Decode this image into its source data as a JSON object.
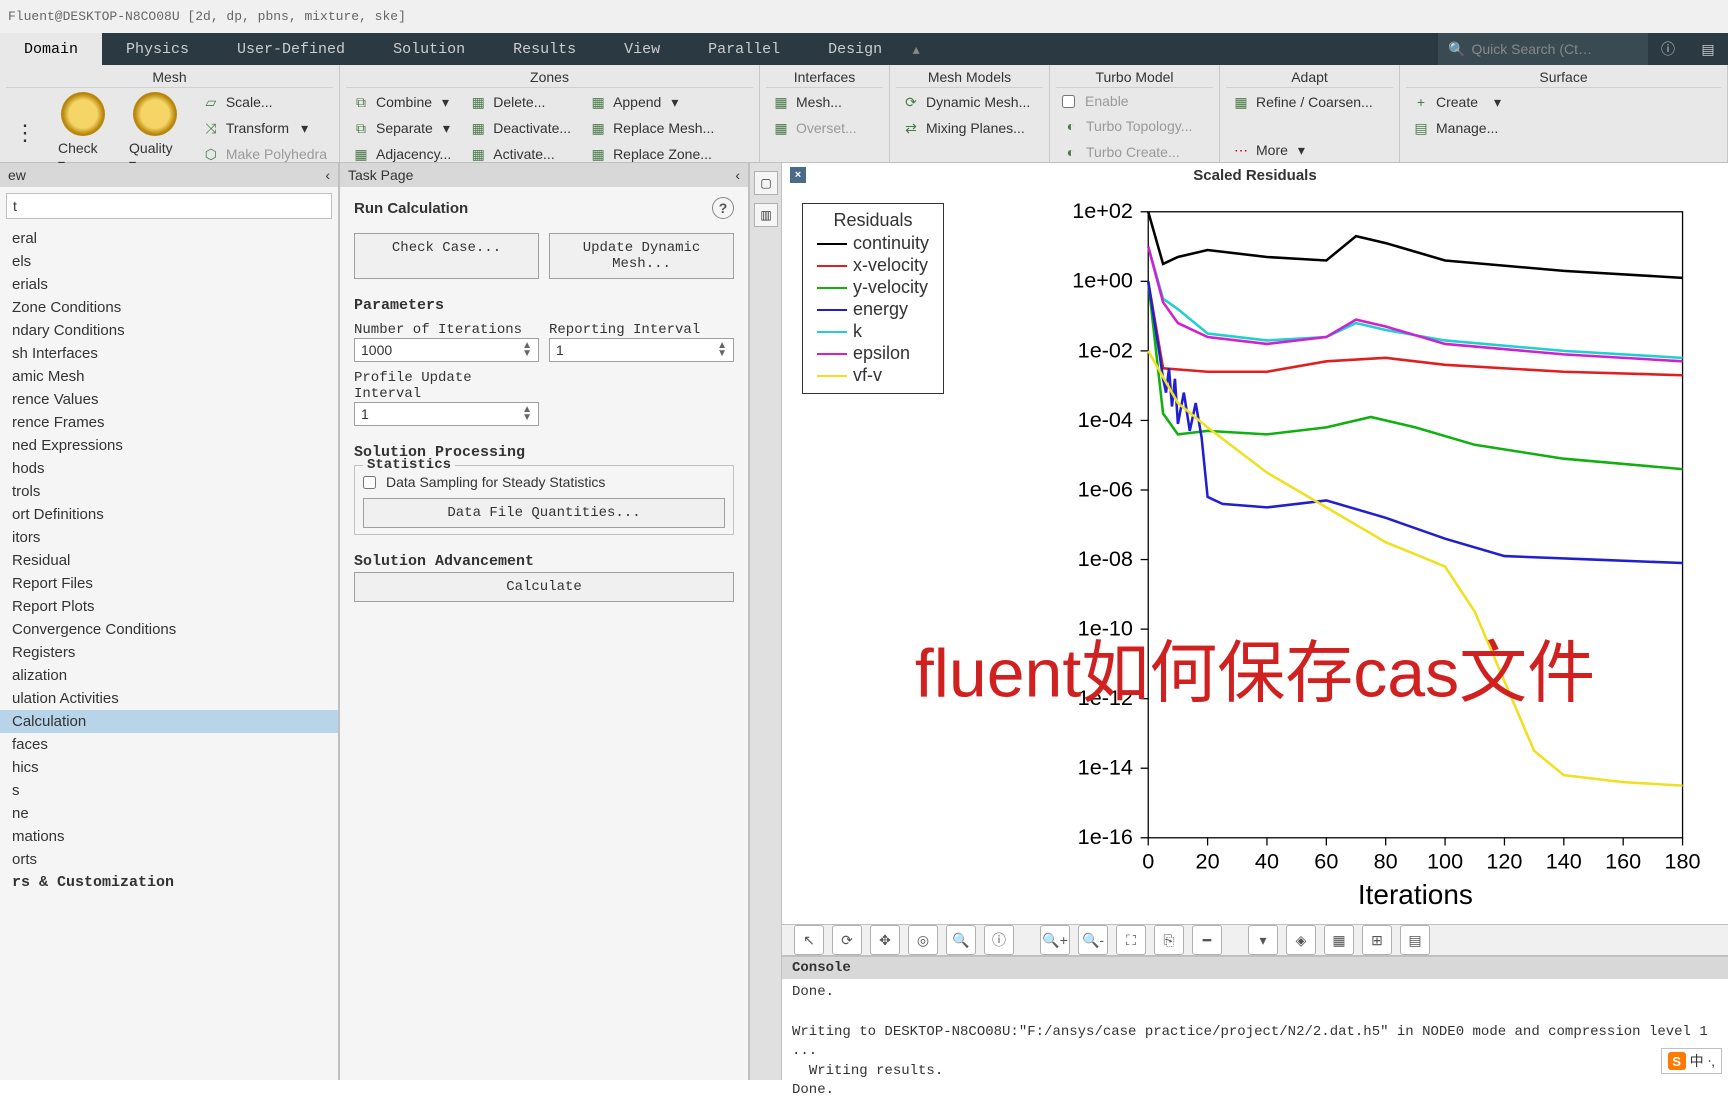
{
  "titlebar": "Fluent@DESKTOP-N8CO08U [2d, dp, pbns, mixture, ske]",
  "menu": {
    "tabs": [
      "Domain",
      "Physics",
      "User-Defined",
      "Solution",
      "Results",
      "View",
      "Parallel",
      "Design"
    ],
    "active": 0,
    "search_placeholder": "Quick Search (Ct…"
  },
  "ribbon": {
    "mesh": {
      "title": "Mesh",
      "check": "Check ▾",
      "quality": "Quality ▾",
      "scale": "Scale...",
      "transform": "Transform",
      "make_poly": "Make Polyhedra"
    },
    "zones": {
      "title": "Zones",
      "combine": "Combine",
      "delete": "Delete...",
      "append": "Append",
      "separate": "Separate",
      "deactivate": "Deactivate...",
      "replace_mesh": "Replace Mesh...",
      "adjacency": "Adjacency...",
      "activate": "Activate...",
      "replace_zone": "Replace Zone..."
    },
    "interfaces": {
      "title": "Interfaces",
      "mesh": "Mesh...",
      "overset": "Overset..."
    },
    "mesh_models": {
      "title": "Mesh Models",
      "dynamic": "Dynamic Mesh...",
      "mixing": "Mixing Planes..."
    },
    "turbo": {
      "title": "Turbo Model",
      "enable": "Enable",
      "topology": "Turbo Topology...",
      "create": "Turbo Create..."
    },
    "adapt": {
      "title": "Adapt",
      "refine": "Refine / Coarsen...",
      "more": "More"
    },
    "surface": {
      "title": "Surface",
      "create": "Create",
      "manage": "Manage..."
    }
  },
  "outline": {
    "title": "ew",
    "filter": "t",
    "items": [
      "eral",
      "els",
      "erials",
      "Zone Conditions",
      "ndary Conditions",
      "sh Interfaces",
      "amic Mesh",
      "rence Values",
      "rence Frames",
      "ned Expressions",
      "hods",
      "trols",
      "ort Definitions",
      "itors",
      "Residual",
      "Report Files",
      "Report Plots",
      "Convergence Conditions",
      "Registers",
      "alization",
      "ulation Activities",
      "Calculation",
      "faces",
      "hics",
      "s",
      "ne",
      "mations",
      "orts"
    ],
    "bold_section": "rs & Customization",
    "selected_index": 21
  },
  "task": {
    "header": "Task Page",
    "title": "Run Calculation",
    "check_case": "Check Case...",
    "update_mesh": "Update Dynamic Mesh...",
    "parameters": "Parameters",
    "num_iter_label": "Number of Iterations",
    "num_iter_value": "1000",
    "report_interval_label": "Reporting Interval",
    "report_interval_value": "1",
    "profile_label": "Profile Update Interval",
    "profile_value": "1",
    "sol_proc": "Solution Processing",
    "statistics": "Statistics",
    "sampling_cb": "Data Sampling for Steady Statistics",
    "data_file_q": "Data File Quantities...",
    "sol_adv": "Solution Advancement",
    "calculate": "Calculate"
  },
  "graphics": {
    "title": "Scaled Residuals",
    "legend_title": "Residuals",
    "legend": [
      {
        "name": "continuity",
        "color": "#000000"
      },
      {
        "name": "x-velocity",
        "color": "#e02020"
      },
      {
        "name": "y-velocity",
        "color": "#10b010"
      },
      {
        "name": "energy",
        "color": "#2020d0"
      },
      {
        "name": "k",
        "color": "#20d0d0"
      },
      {
        "name": "epsilon",
        "color": "#d020d0"
      },
      {
        "name": "vf-v",
        "color": "#f0e020"
      }
    ],
    "xlabel": "Iterations"
  },
  "chart_data": {
    "type": "line",
    "title": "Scaled Residuals",
    "xlabel": "Iterations",
    "ylabel": "",
    "x_ticks": [
      0,
      20,
      40,
      60,
      80,
      100,
      120,
      140,
      160,
      180
    ],
    "y_ticks_log10": [
      2,
      0,
      -2,
      -4,
      -6,
      -8,
      -10,
      -12,
      -14,
      -16
    ],
    "y_tick_labels": [
      "1e+02",
      "1e+00",
      "1e-02",
      "1e-04",
      "1e-06",
      "1e-08",
      "1e-10",
      "1e-12",
      "1e-14",
      "1e-16"
    ],
    "xlim": [
      0,
      180
    ],
    "ylim_log10": [
      -16,
      2
    ],
    "series": [
      {
        "name": "continuity",
        "color": "#000000",
        "x": [
          0,
          5,
          10,
          20,
          40,
          60,
          70,
          80,
          100,
          140,
          180
        ],
        "y_log10": [
          2,
          0.5,
          0.7,
          0.9,
          0.7,
          0.6,
          1.3,
          1.1,
          0.6,
          0.3,
          0.1
        ]
      },
      {
        "name": "x-velocity",
        "color": "#e02020",
        "x": [
          0,
          5,
          20,
          40,
          60,
          80,
          100,
          140,
          180
        ],
        "y_log10": [
          0,
          -2.5,
          -2.6,
          -2.6,
          -2.3,
          -2.2,
          -2.4,
          -2.6,
          -2.7
        ]
      },
      {
        "name": "y-velocity",
        "color": "#10b010",
        "x": [
          0,
          5,
          10,
          20,
          40,
          60,
          75,
          90,
          110,
          140,
          180
        ],
        "y_log10": [
          0,
          -3.8,
          -4.4,
          -4.3,
          -4.4,
          -4.2,
          -3.9,
          -4.2,
          -4.7,
          -5.1,
          -5.4
        ]
      },
      {
        "name": "energy",
        "color": "#2020d0",
        "x": [
          0,
          4,
          5,
          6,
          7,
          8,
          9,
          10,
          12,
          14,
          16,
          18,
          20,
          25,
          40,
          60,
          80,
          100,
          120,
          150,
          180
        ],
        "y_log10": [
          0,
          -2.2,
          -2.8,
          -3.2,
          -2.5,
          -3.6,
          -2.8,
          -4.1,
          -3.2,
          -4.3,
          -3.5,
          -4.5,
          -6.2,
          -6.4,
          -6.5,
          -6.3,
          -6.8,
          -7.4,
          -7.9,
          -8.0,
          -8.1
        ]
      },
      {
        "name": "k",
        "color": "#20d0d0",
        "x": [
          0,
          5,
          10,
          20,
          40,
          60,
          70,
          80,
          100,
          140,
          180
        ],
        "y_log10": [
          1,
          -0.5,
          -0.8,
          -1.5,
          -1.7,
          -1.6,
          -1.2,
          -1.4,
          -1.7,
          -2.0,
          -2.2
        ]
      },
      {
        "name": "epsilon",
        "color": "#d020d0",
        "x": [
          0,
          5,
          10,
          20,
          40,
          60,
          70,
          80,
          100,
          140,
          180
        ],
        "y_log10": [
          1,
          -0.6,
          -1.2,
          -1.6,
          -1.8,
          -1.6,
          -1.1,
          -1.3,
          -1.8,
          -2.1,
          -2.3
        ]
      },
      {
        "name": "vf-v",
        "color": "#f0e020",
        "x": [
          0,
          10,
          20,
          40,
          60,
          80,
          100,
          110,
          120,
          130,
          140,
          160,
          180
        ],
        "y_log10": [
          -2,
          -3.5,
          -4.2,
          -5.5,
          -6.5,
          -7.5,
          -8.2,
          -9.5,
          -11.5,
          -13.5,
          -14.2,
          -14.4,
          -14.5
        ]
      }
    ]
  },
  "console": {
    "title": "Console",
    "text": "Done.\n\nWriting to DESKTOP-N8CO08U:\"F:/ansys/case practice/project/N2/2.dat.h5\" in NODE0 mode and compression level 1 ...\n  Writing results.\nDone."
  },
  "overlay": "fluent如何保存cas文件",
  "ime": "中 ᐧ,"
}
